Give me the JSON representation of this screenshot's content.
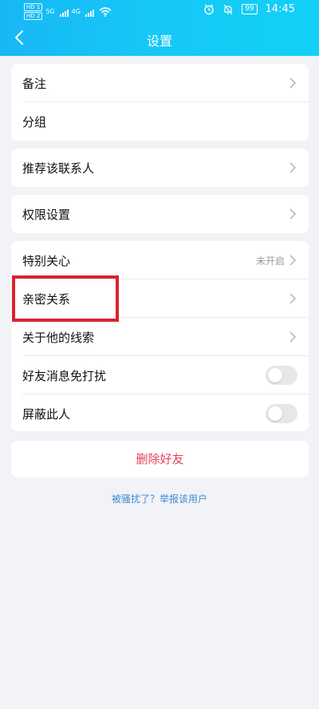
{
  "status_bar": {
    "badges": [
      "HD 1",
      "HD 2"
    ],
    "net_types": [
      "5G",
      "4G"
    ],
    "time": "14:45",
    "battery": "99"
  },
  "header": {
    "title": "设置"
  },
  "groups": {
    "g1": [
      {
        "label": "备注"
      },
      {
        "label": "分组"
      }
    ],
    "g2": [
      {
        "label": "推荐该联系人"
      }
    ],
    "g3": [
      {
        "label": "权限设置"
      }
    ],
    "g4": [
      {
        "label": "特别关心",
        "status": "未开启"
      },
      {
        "label": "亲密关系"
      },
      {
        "label": "关于他的线索"
      },
      {
        "label": "好友消息免打扰",
        "toggle": false
      },
      {
        "label": "屏蔽此人",
        "toggle": false
      }
    ]
  },
  "actions": {
    "delete_label": "删除好友",
    "report_label": "被骚扰了？举报该用户"
  },
  "colors": {
    "header_gradient_start": "#17b7f6",
    "header_gradient_end": "#12d1f6",
    "delete_text": "#e2455c",
    "link_text": "#3e8ccf",
    "highlight_box": "#d9232f"
  }
}
